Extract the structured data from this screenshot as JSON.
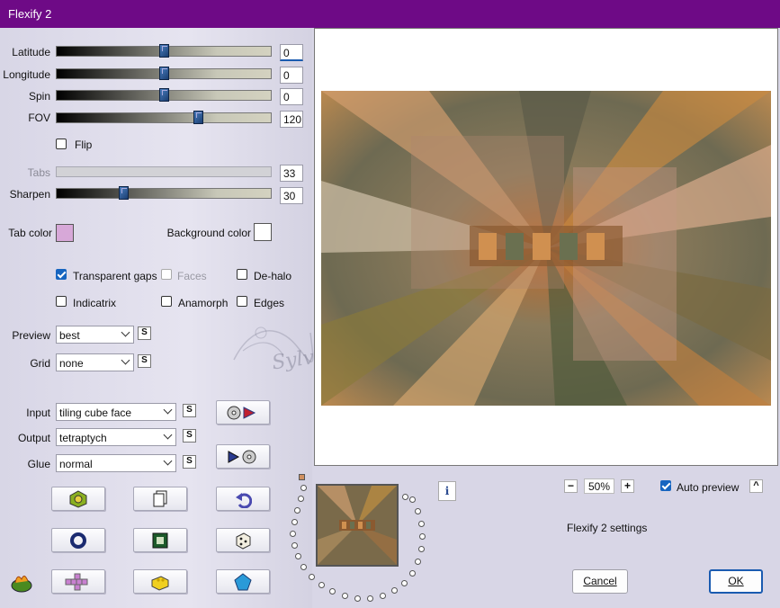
{
  "title": "Flexify 2",
  "sliders": [
    {
      "label": "Latitude",
      "value": "0",
      "fraction": 0.5
    },
    {
      "label": "Longitude",
      "value": "0",
      "fraction": 0.5
    },
    {
      "label": "Spin",
      "value": "0",
      "fraction": 0.5
    },
    {
      "label": "FOV",
      "value": "120",
      "fraction": 0.66
    },
    {
      "label": "Tabs",
      "value": "33",
      "disabled": true
    },
    {
      "label": "Sharpen",
      "value": "30",
      "fraction": 0.31
    }
  ],
  "flip_label": "Flip",
  "tab_color_label": "Tab color",
  "tab_color": "#d7a8d8",
  "background_color_label": "Background color",
  "background_color": "#ffffff",
  "checks": {
    "transparent_gaps": "Transparent gaps",
    "faces": "Faces",
    "de_halo": "De-halo",
    "indicatrix": "Indicatrix",
    "anamorph": "Anamorph",
    "edges": "Edges"
  },
  "preview_label": "Preview",
  "preview_value": "best",
  "grid_label": "Grid",
  "grid_value": "none",
  "input_label": "Input",
  "input_value": "tiling cube face",
  "output_label": "Output",
  "output_value": "tetraptych",
  "glue_label": "Glue",
  "glue_value": "normal",
  "s_label": "S",
  "watermark": "Sylviane",
  "zoom_value": "50%",
  "zoom_minus": "−",
  "zoom_plus": "+",
  "auto_preview_label": "Auto preview",
  "collapse_glyph": "^",
  "settings_label": "Flexify 2 settings",
  "info_glyph": "i",
  "cancel_label": "Cancel",
  "ok_label": "OK",
  "colors": {
    "title_bar": "#6e0a86",
    "accent": "#1765c0",
    "panel": "#d8d6e6"
  }
}
